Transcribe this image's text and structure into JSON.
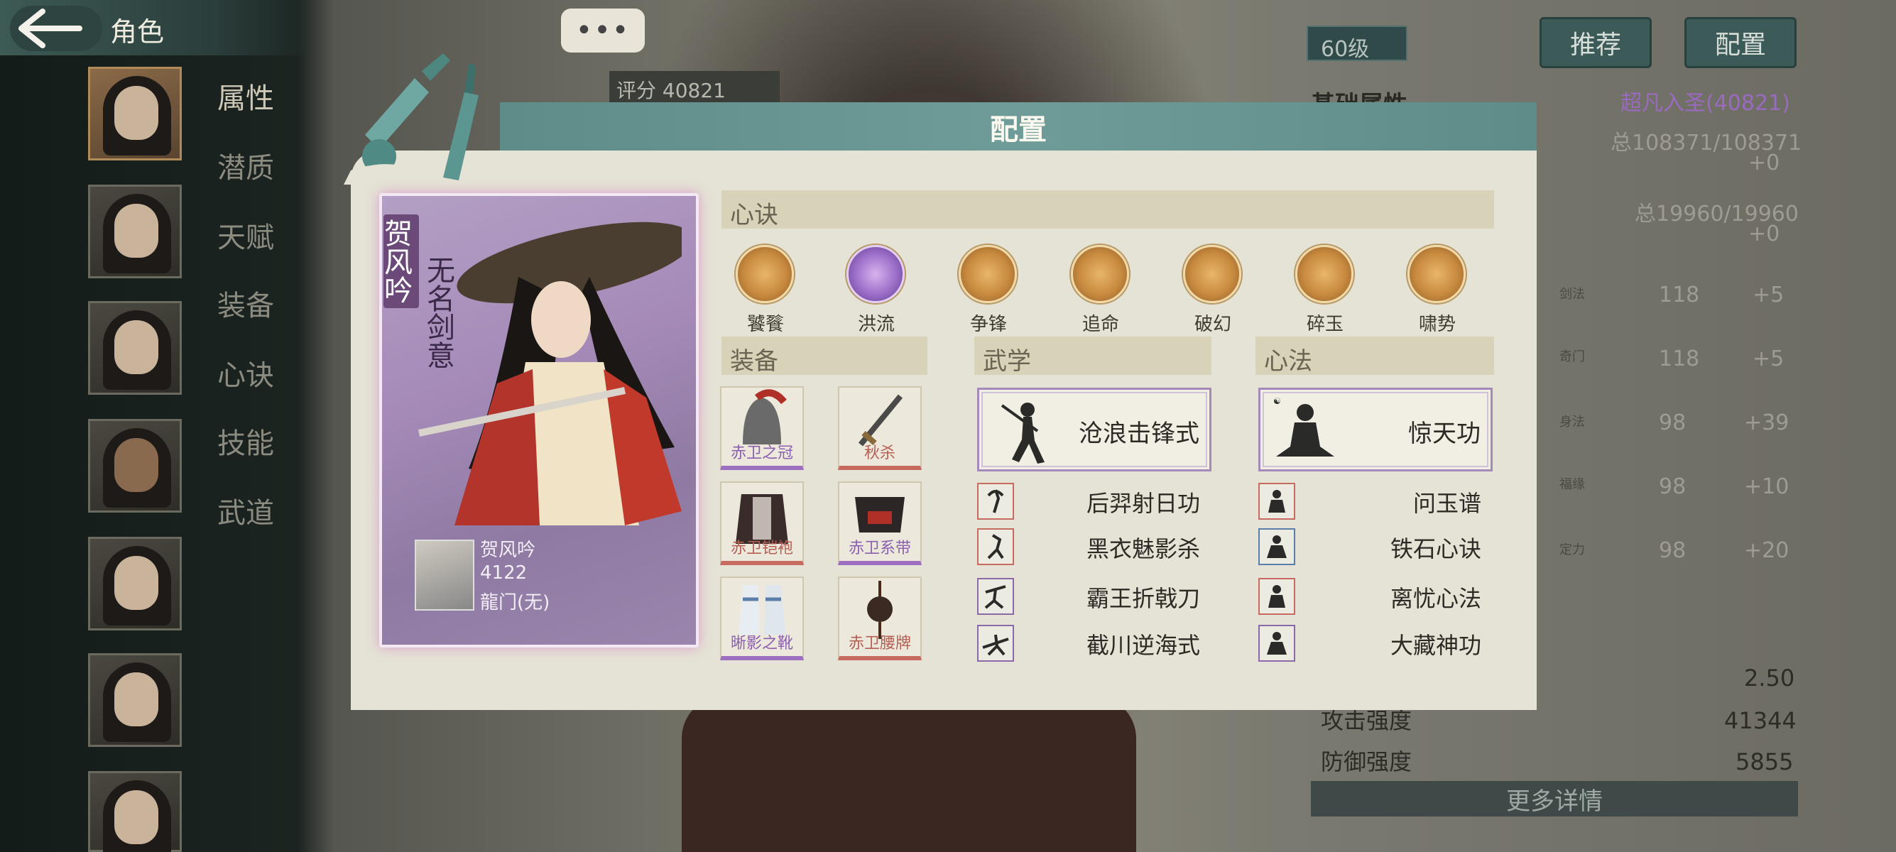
{
  "topbar": {
    "title": "角色"
  },
  "background": {
    "chat_dots": "•••",
    "score_label": "评分",
    "score_value": "40821",
    "level": "60级",
    "recommend_label": "推荐",
    "config_label": "配置",
    "base_attr_label": "基础属性",
    "realm": "超凡入圣(40821)",
    "stat_total_1": "总108371/108371",
    "stat_plus_1": "+0",
    "stat_total_2": "总19960/19960",
    "stat_plus_2": "+0",
    "stat_rows": [
      {
        "label": "剑法",
        "value": "118",
        "bonus": "+5"
      },
      {
        "label": "奇门",
        "value": "118",
        "bonus": "+5"
      },
      {
        "label": "身法",
        "value": "98",
        "bonus": "+39"
      },
      {
        "label": "福缘",
        "value": "98",
        "bonus": "+10"
      },
      {
        "label": "定力",
        "value": "98",
        "bonus": "+20"
      }
    ],
    "extra_value": "2.50",
    "attack_label": "攻击强度",
    "attack_value": "41344",
    "defense_label": "防御强度",
    "defense_value": "5855",
    "more_label": "更多详情"
  },
  "sidebar": {
    "tabs": [
      "属性",
      "潜质",
      "天赋",
      "装备",
      "心诀",
      "技能",
      "武道"
    ]
  },
  "modal": {
    "title": "配置",
    "card": {
      "name": "贺风吟",
      "subtitle": "无名剑意",
      "mini_name": "贺风吟",
      "power": "4122",
      "sect": "龍门(无)"
    },
    "xinjue": {
      "header": "心诀",
      "items": [
        "饕餮",
        "洪流",
        "争锋",
        "追命",
        "破幻",
        "碎玉",
        "啸势"
      ]
    },
    "equip": {
      "header": "装备",
      "items": [
        "赤卫之冠",
        "秋杀",
        "赤卫铠袍",
        "赤卫系带",
        "晰影之靴",
        "赤卫腰牌"
      ]
    },
    "wuxue": {
      "header": "武学",
      "main": "沧浪击锋式",
      "items": [
        "后羿射日功",
        "黑衣魅影杀",
        "霸王折戟刀",
        "截川逆海式"
      ]
    },
    "xinfa": {
      "header": "心法",
      "main": "惊天功",
      "items": [
        "问玉谱",
        "铁石心诀",
        "离忧心法",
        "大藏神功"
      ]
    }
  }
}
